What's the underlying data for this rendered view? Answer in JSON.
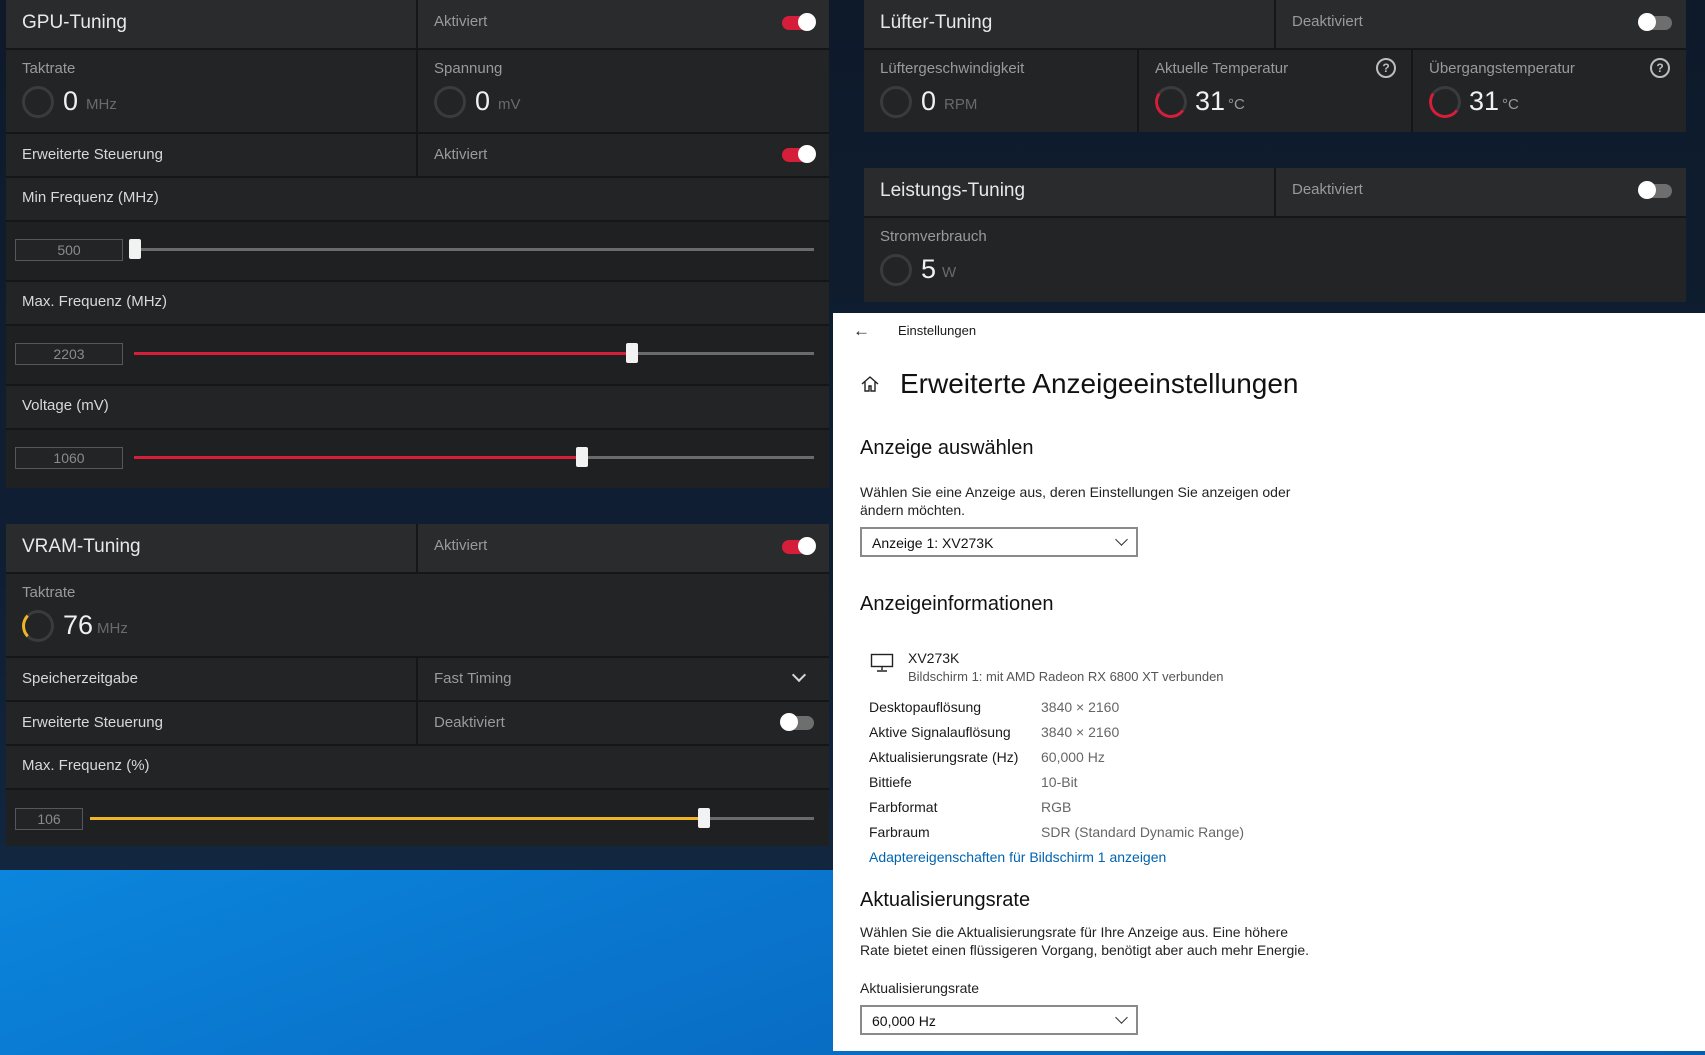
{
  "gpu": {
    "title": "GPU-Tuning",
    "state": "Aktiviert",
    "taktrate_label": "Taktrate",
    "taktrate_value": "0",
    "taktrate_unit": "MHz",
    "spannung_label": "Spannung",
    "spannung_value": "0",
    "spannung_unit": "mV",
    "erweitert_label": "Erweiterte Steuerung",
    "erweitert_state": "Aktiviert",
    "min_freq_label": "Min Frequenz (MHz)",
    "min_freq_value": "500",
    "max_freq_label": "Max. Frequenz (MHz)",
    "max_freq_value": "2203",
    "voltage_label": "Voltage (mV)",
    "voltage_value": "1060"
  },
  "vram": {
    "title": "VRAM-Tuning",
    "state": "Aktiviert",
    "taktrate_label": "Taktrate",
    "taktrate_value": "76",
    "taktrate_unit": "MHz",
    "timing_label": "Speicherzeitgabe",
    "timing_value": "Fast Timing",
    "erweitert_label": "Erweiterte Steuerung",
    "erweitert_state": "Deaktiviert",
    "max_freq_label": "Max. Frequenz (%)",
    "max_freq_value": "106"
  },
  "fan": {
    "title": "Lüfter-Tuning",
    "state": "Deaktiviert",
    "speed_label": "Lüftergeschwindigkeit",
    "speed_value": "0",
    "speed_unit": "RPM",
    "temp_label": "Aktuelle Temperatur",
    "temp_value": "31",
    "temp_unit": "°C",
    "junction_label": "Übergangstemperatur",
    "junction_value": "31",
    "junction_unit": "°C",
    "help_glyph": "?"
  },
  "power": {
    "title": "Leistungs-Tuning",
    "state": "Deaktiviert",
    "usage_label": "Stromverbrauch",
    "usage_value": "5",
    "usage_unit": "W"
  },
  "settings": {
    "back_label": "Einstellungen",
    "page_title": "Erweiterte Anzeigeeinstellungen",
    "select_heading": "Anzeige auswählen",
    "select_desc_1": "Wählen Sie eine Anzeige aus, deren Einstellungen Sie anzeigen oder",
    "select_desc_2": "ändern möchten.",
    "display_combo": "Anzeige 1: XV273K",
    "info_heading": "Anzeigeinformationen",
    "monitor_name": "XV273K",
    "monitor_sub": "Bildschirm 1: mit AMD Radeon RX 6800 XT verbunden",
    "info": [
      {
        "k": "Desktopauflösung",
        "v": "3840 × 2160"
      },
      {
        "k": "Aktive Signalauflösung",
        "v": "3840 × 2160"
      },
      {
        "k": "Aktualisierungsrate (Hz)",
        "v": "60,000 Hz"
      },
      {
        "k": "Bittiefe",
        "v": "10-Bit"
      },
      {
        "k": "Farbformat",
        "v": "RGB"
      },
      {
        "k": "Farbraum",
        "v": "SDR (Standard Dynamic Range)"
      }
    ],
    "adapter_link": "Adaptereigenschaften für Bildschirm 1 anzeigen",
    "refresh_heading": "Aktualisierungsrate",
    "refresh_desc_1": "Wählen Sie die Aktualisierungsrate für Ihre Anzeige aus. Eine höhere",
    "refresh_desc_2": "Rate bietet einen flüssigeren Vorgang, benötigt aber auch mehr Energie.",
    "refresh_label": "Aktualisierungsrate",
    "refresh_combo": "60,000 Hz"
  },
  "colors": {
    "accent_red": "#d51e3a",
    "accent_yellow": "#f0b429",
    "link_blue": "#0063b1"
  },
  "sliders": {
    "min_freq_fraction": 0.0,
    "max_freq_fraction": 0.74,
    "voltage_fraction": 0.66,
    "vram_fraction": 0.85
  }
}
